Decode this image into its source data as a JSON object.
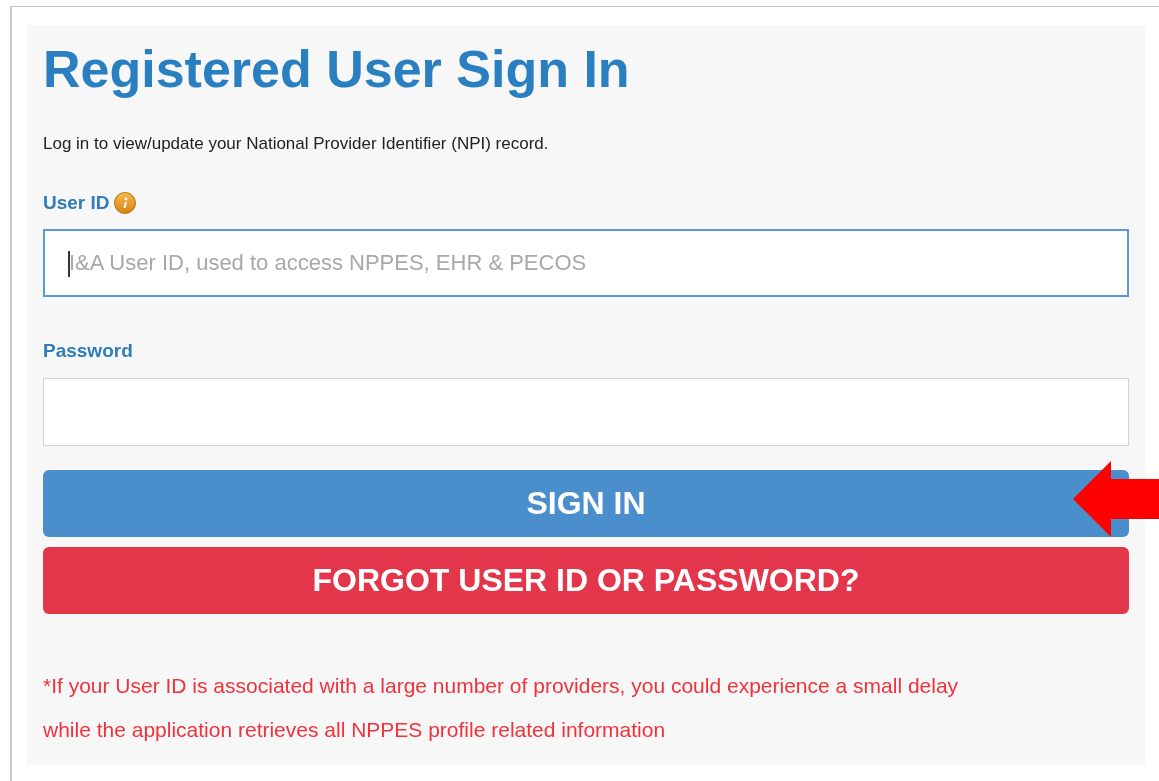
{
  "title": "Registered User Sign In",
  "subtitle": "Log in to view/update your National Provider Identifier (NPI) record.",
  "fields": [
    {
      "label": "User ID",
      "info_icon": true,
      "focused": true,
      "placeholder": "I&A User ID, used to access NPPES, EHR & PECOS"
    },
    {
      "label": "Password",
      "info_icon": false,
      "focused": false
    }
  ],
  "buttons": [
    {
      "label": "SIGN IN",
      "kind": "primary"
    },
    {
      "label": "FORGOT USER ID OR PASSWORD?",
      "kind": "danger"
    }
  ],
  "note": "*If your User ID is associated with a large number of providers, you could experience a small delay while the application retrieves all NPPES profile related information"
}
